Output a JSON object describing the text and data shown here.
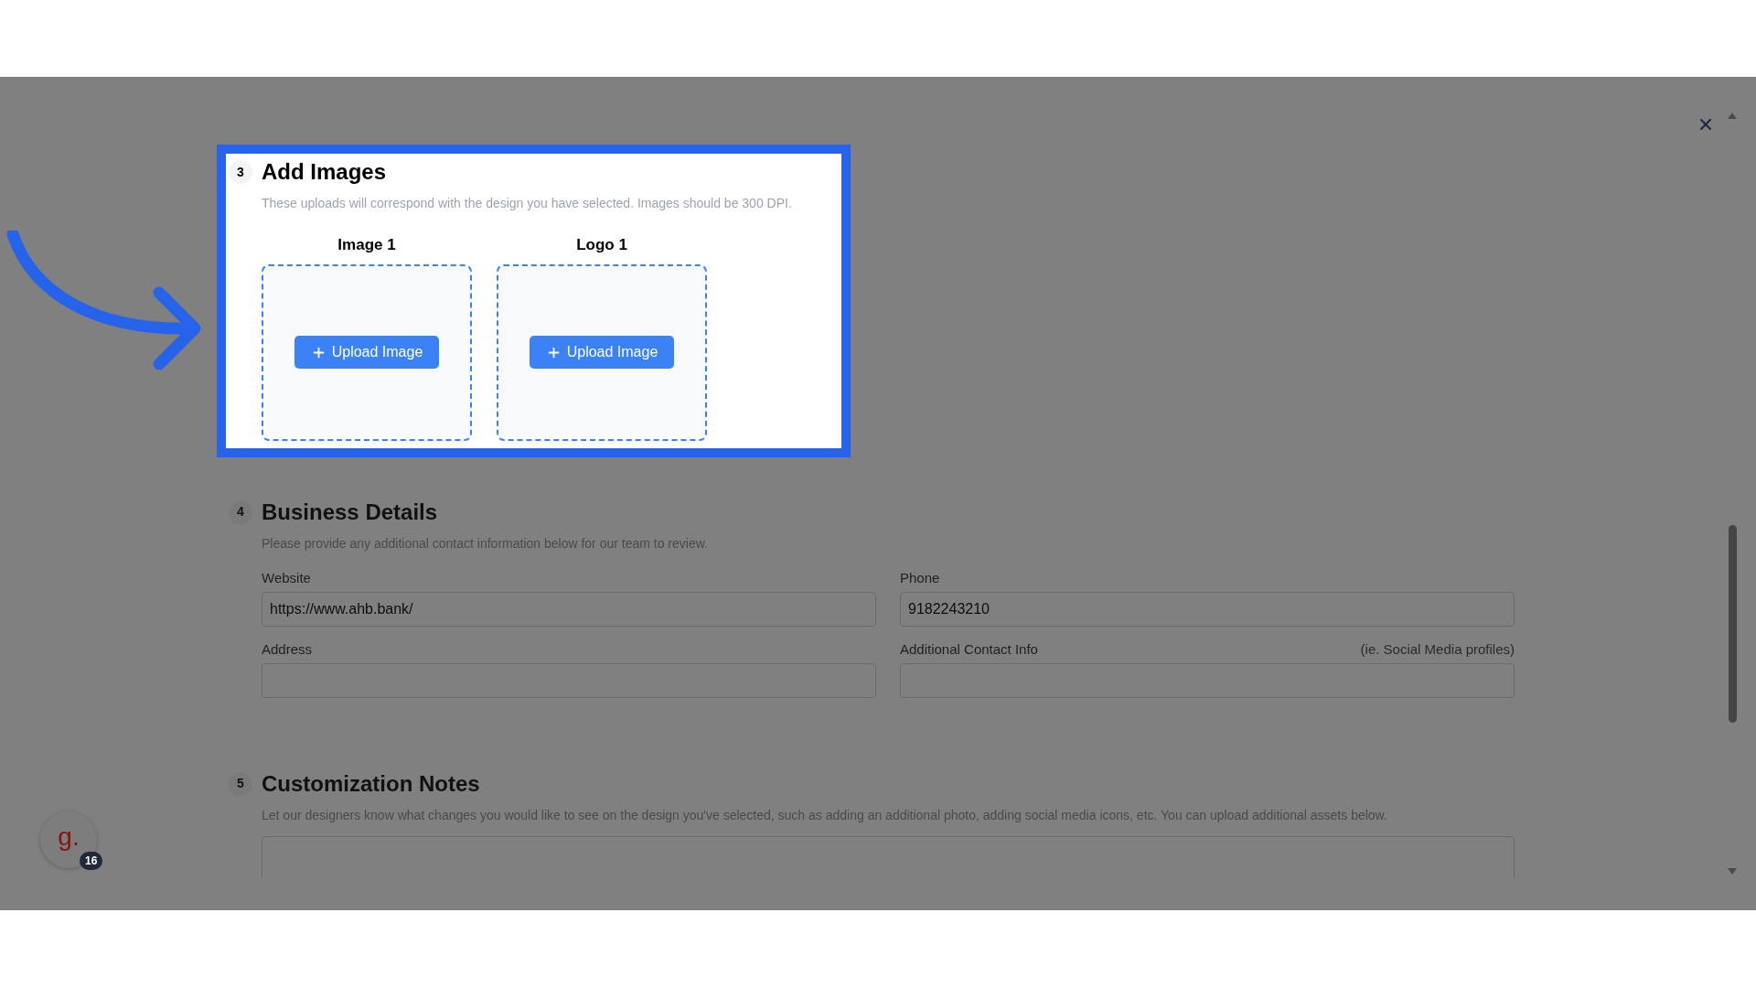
{
  "sections": [
    {
      "number": "3",
      "title": "Add Images",
      "description": "These uploads will correspond with the design you have selected. Images should be 300 DPI.",
      "highlighted": true,
      "kind": "uploads",
      "uploads": [
        {
          "label": "Image 1",
          "button": "Upload Image"
        },
        {
          "label": "Logo 1",
          "button": "Upload Image"
        }
      ]
    },
    {
      "number": "4",
      "title": "Business Details",
      "description": "Please provide any additional contact information below for our team to review.",
      "highlighted": false,
      "kind": "fields",
      "fields": [
        {
          "label": "Website",
          "value": "https://www.ahb.bank/"
        },
        {
          "label": "Phone",
          "value": "9182243210"
        },
        {
          "label": "Address"
        },
        {
          "label": "Additional Contact Info",
          "hint": "(ie. Social Media profiles)"
        }
      ]
    },
    {
      "number": "5",
      "title": "Customization Notes",
      "description": "Let our designers know what changes you would like to see on the design you've selected, such as adding an additional photo, adding social media icons, etc. You can upload additional assets below.",
      "highlighted": false,
      "kind": "notes"
    }
  ],
  "avatar": {
    "letter": "g.",
    "badge": "16"
  }
}
